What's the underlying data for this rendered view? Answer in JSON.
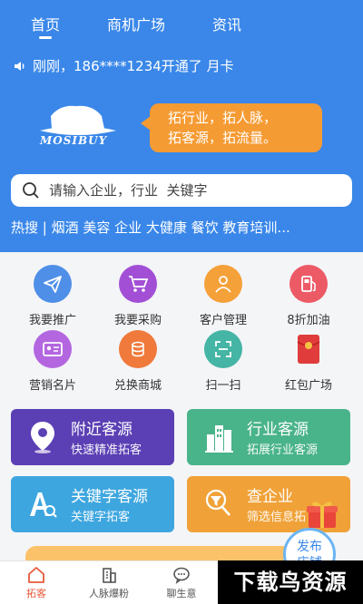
{
  "header": {
    "tabs": [
      {
        "label": "首页"
      },
      {
        "label": "商机广场"
      },
      {
        "label": "资讯"
      }
    ]
  },
  "notice": {
    "text": "刚刚，186****1234开通了 月卡"
  },
  "logo": {
    "text": "MOSIBUY"
  },
  "bubble": {
    "line1": "拓行业，拓人脉，",
    "line2": "拓客源，拓流量。"
  },
  "search": {
    "placeholder": "请输入企业，行业  关键字"
  },
  "hot_search": {
    "text": "热搜 | 烟酒 美容 企业 大健康 餐饮 教育培训..."
  },
  "grid": {
    "items": [
      {
        "label": "我要推广",
        "icon": "paper-plane-icon",
        "color": "#4f8fe8"
      },
      {
        "label": "我要采购",
        "icon": "cart-icon",
        "color": "#a24fd6"
      },
      {
        "label": "客户管理",
        "icon": "customer-icon",
        "color": "#f5a13a"
      },
      {
        "label": "8折加油",
        "icon": "fuel-icon",
        "color": "#ec5a66"
      },
      {
        "label": "营销名片",
        "icon": "card-icon",
        "color": "#b466e0"
      },
      {
        "label": "兑换商城",
        "icon": "coins-icon",
        "color": "#f07a3c"
      },
      {
        "label": "扫一扫",
        "icon": "scan-icon",
        "color": "#45b5a5"
      },
      {
        "label": "红包广场",
        "icon": "red-packet-icon",
        "color": "#e03c3c"
      }
    ]
  },
  "cards": [
    {
      "title": "附近客源",
      "subtitle": "快速精准拓客",
      "color": "#5b3fb4",
      "icon": "location-pin-icon"
    },
    {
      "title": "行业客源",
      "subtitle": "拓展行业客源",
      "color": "#49b38a",
      "icon": "buildings-icon"
    },
    {
      "title": "关键字客源",
      "subtitle": "关键字拓客",
      "color": "#3ea6df",
      "icon": "keyword-search-icon"
    },
    {
      "title": "查企业",
      "subtitle": "筛选信息拓",
      "color": "#f0a238",
      "icon": "filter-icon"
    }
  ],
  "publish": {
    "label": "发布\n店铺"
  },
  "bottom_nav": {
    "items": [
      {
        "label": "拓客",
        "icon": "home-icon"
      },
      {
        "label": "人脉爆粉",
        "icon": "building-icon"
      },
      {
        "label": "聊生意",
        "icon": "chat-icon"
      }
    ]
  },
  "watermark": {
    "text": "下载鸟资源"
  },
  "colors": {
    "primary": "#3a87e9",
    "accent": "#f59b33"
  }
}
